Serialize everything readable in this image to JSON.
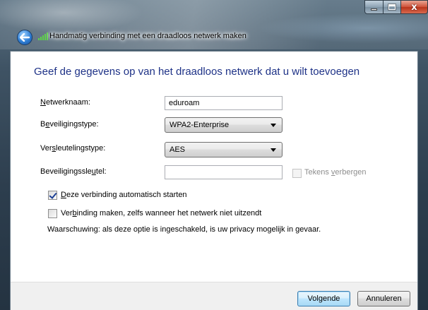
{
  "window": {
    "title": "Handmatig verbinding met een draadloos netwerk maken"
  },
  "heading": "Geef de gegevens op van het draadloos netwerk dat u wilt toevoegen",
  "form": {
    "network_name": {
      "label_pre": "",
      "label_key": "N",
      "label_post": "etwerknaam:",
      "value": "eduroam"
    },
    "security_type": {
      "label_pre": "B",
      "label_key": "e",
      "label_post": "veiligingstype:",
      "value": "WPA2-Enterprise"
    },
    "encryption_type": {
      "label_pre": "Ver",
      "label_key": "s",
      "label_post": "leutelingstype:",
      "value": "AES"
    },
    "security_key": {
      "label_pre": "Beveiligingssle",
      "label_key": "u",
      "label_post": "tel:",
      "value": ""
    },
    "hide_chars": {
      "label_pre": "Tekens ",
      "label_key": "v",
      "label_post": "erbergen",
      "checked": false,
      "enabled": false
    }
  },
  "options": {
    "auto_start": {
      "label_pre": "",
      "label_key": "D",
      "label_post": "eze verbinding automatisch starten",
      "checked": true
    },
    "connect_hidden": {
      "label_pre": "Ver",
      "label_key": "b",
      "label_post": "inding maken, zelfs wanneer het netwerk niet uitzendt",
      "checked": false
    },
    "warning": "Waarschuwing: als deze optie is ingeschakeld, is uw privacy mogelijk in gevaar."
  },
  "buttons": {
    "next": "Volgende",
    "cancel": "Annuleren",
    "close_glyph": "x"
  },
  "colors": {
    "heading": "#1e3287",
    "close_button": "#c7472d",
    "signal": "#5fd34a"
  },
  "icons": {
    "back": "back-arrow-icon",
    "signal": "wireless-signal-icon"
  }
}
